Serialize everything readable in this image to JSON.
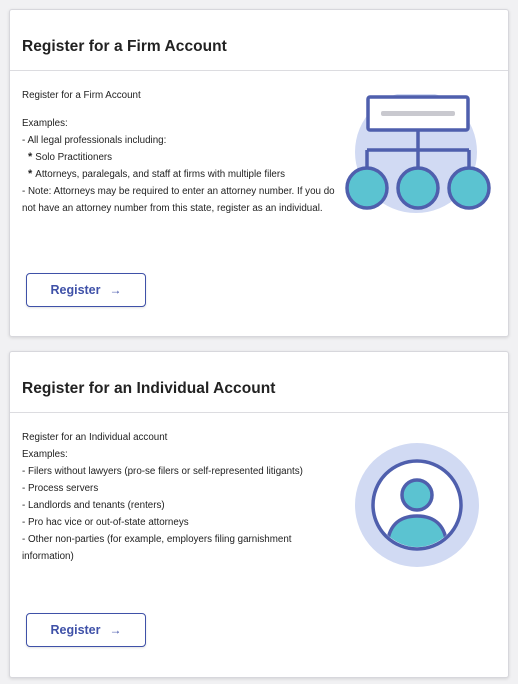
{
  "firm_card": {
    "title": "Register for a Firm Account",
    "intro": "Register for a Firm Account",
    "examples_heading": "Examples:",
    "line1": "- All legal professionals including:",
    "bullet_mark": "*",
    "sub1": "Solo Practitioners",
    "sub2": "Attorneys, paralegals, and staff at firms with multiple filers",
    "note": "- Note: Attorneys may be required to enter an attorney number. If you do not have an attorney number from this state, register as an individual.",
    "register_label": "Register",
    "register_arrow": "→",
    "illustration_icon": "org-chart-icon"
  },
  "individual_card": {
    "title": "Register for an Individual Account",
    "intro": "Register for an Individual account",
    "examples_heading": "Examples:",
    "items": [
      "- Filers without lawyers (pro-se filers or self-represented litigants)",
      "- Process servers",
      "- Landlords and tenants (renters)",
      "- Pro hac vice or out-of-state attorneys",
      "- Other non-parties (for example, employers filing garnishment information)"
    ],
    "register_label": "Register",
    "register_arrow": "→",
    "illustration_icon": "person-avatar-icon"
  },
  "colors": {
    "accent": "#3f51a8",
    "icon_outline": "#4f5fad",
    "icon_fill": "#5bc3d1",
    "icon_bg": "#d1daf3"
  }
}
